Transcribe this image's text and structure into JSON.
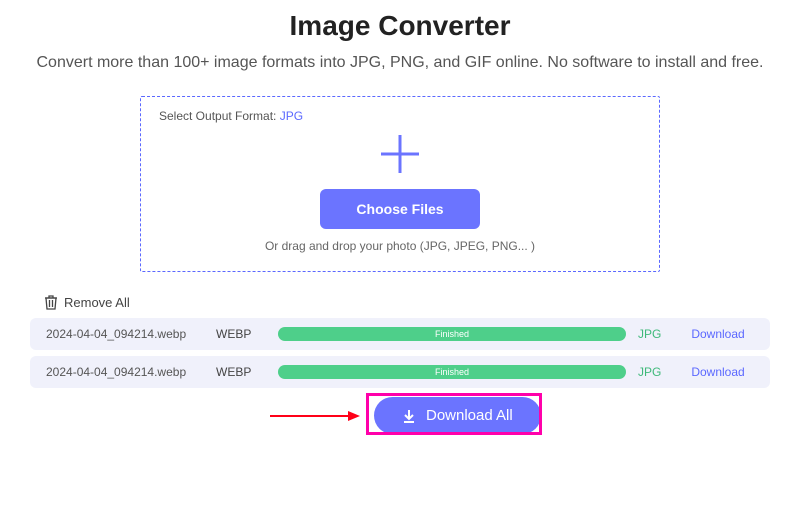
{
  "title": "Image Converter",
  "subtitle": "Convert more than 100+ image formats into JPG, PNG, and GIF online. No software to install and free.",
  "dropzone": {
    "format_label": "Select Output Format:",
    "format_value": "JPG",
    "choose_files": "Choose Files",
    "drop_hint": "Or drag and drop your photo (JPG, JPEG, PNG... )"
  },
  "remove_all": "Remove All",
  "files": [
    {
      "name": "2024-04-04_094214.webp",
      "src_type": "WEBP",
      "status": "Finished",
      "out_type": "JPG",
      "download": "Download"
    },
    {
      "name": "2024-04-04_094214.webp",
      "src_type": "WEBP",
      "status": "Finished",
      "out_type": "JPG",
      "download": "Download"
    }
  ],
  "download_all": "Download All"
}
